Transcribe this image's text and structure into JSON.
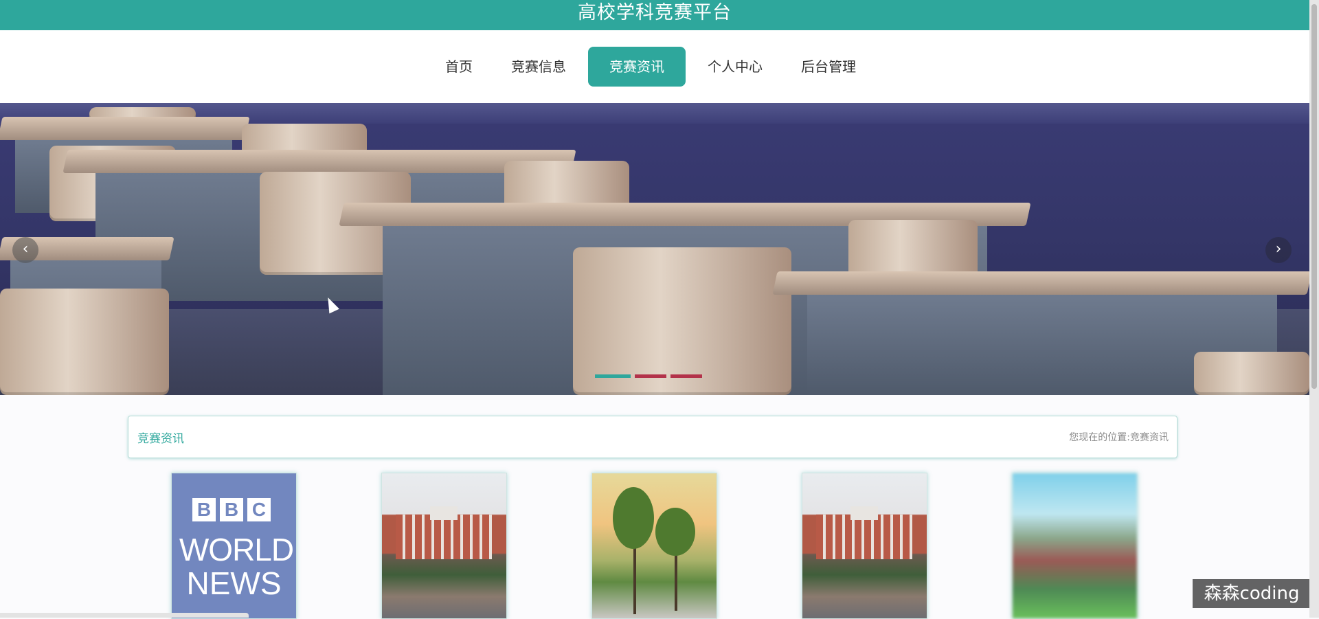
{
  "site": {
    "title": "高校学科竞赛平台"
  },
  "nav": {
    "items": [
      {
        "label": "首页",
        "active": false
      },
      {
        "label": "竞赛信息",
        "active": false
      },
      {
        "label": "竞赛资讯",
        "active": true
      },
      {
        "label": "个人中心",
        "active": false
      },
      {
        "label": "后台管理",
        "active": false
      }
    ]
  },
  "banner": {
    "prev_icon": "chevron-left-icon",
    "next_icon": "chevron-right-icon",
    "prev_glyph": "‹",
    "next_glyph": "›",
    "slides_count": 3,
    "active_slide": 1
  },
  "section": {
    "title": "竞赛资讯",
    "location_label": "您现在的位置:",
    "location_value": "竞赛资讯"
  },
  "cards": [
    {
      "image": "bbc-world-news",
      "letters": [
        "B",
        "B",
        "C"
      ],
      "line1": "WORLD",
      "line2": "NEWS"
    },
    {
      "image": "campus-building"
    },
    {
      "image": "trees-walkway"
    },
    {
      "image": "campus-building"
    },
    {
      "image": "blurred-campus"
    }
  ],
  "watermark": "森森coding",
  "colors": {
    "accent": "#2ea79c",
    "slider_dot": "#b3324a"
  }
}
